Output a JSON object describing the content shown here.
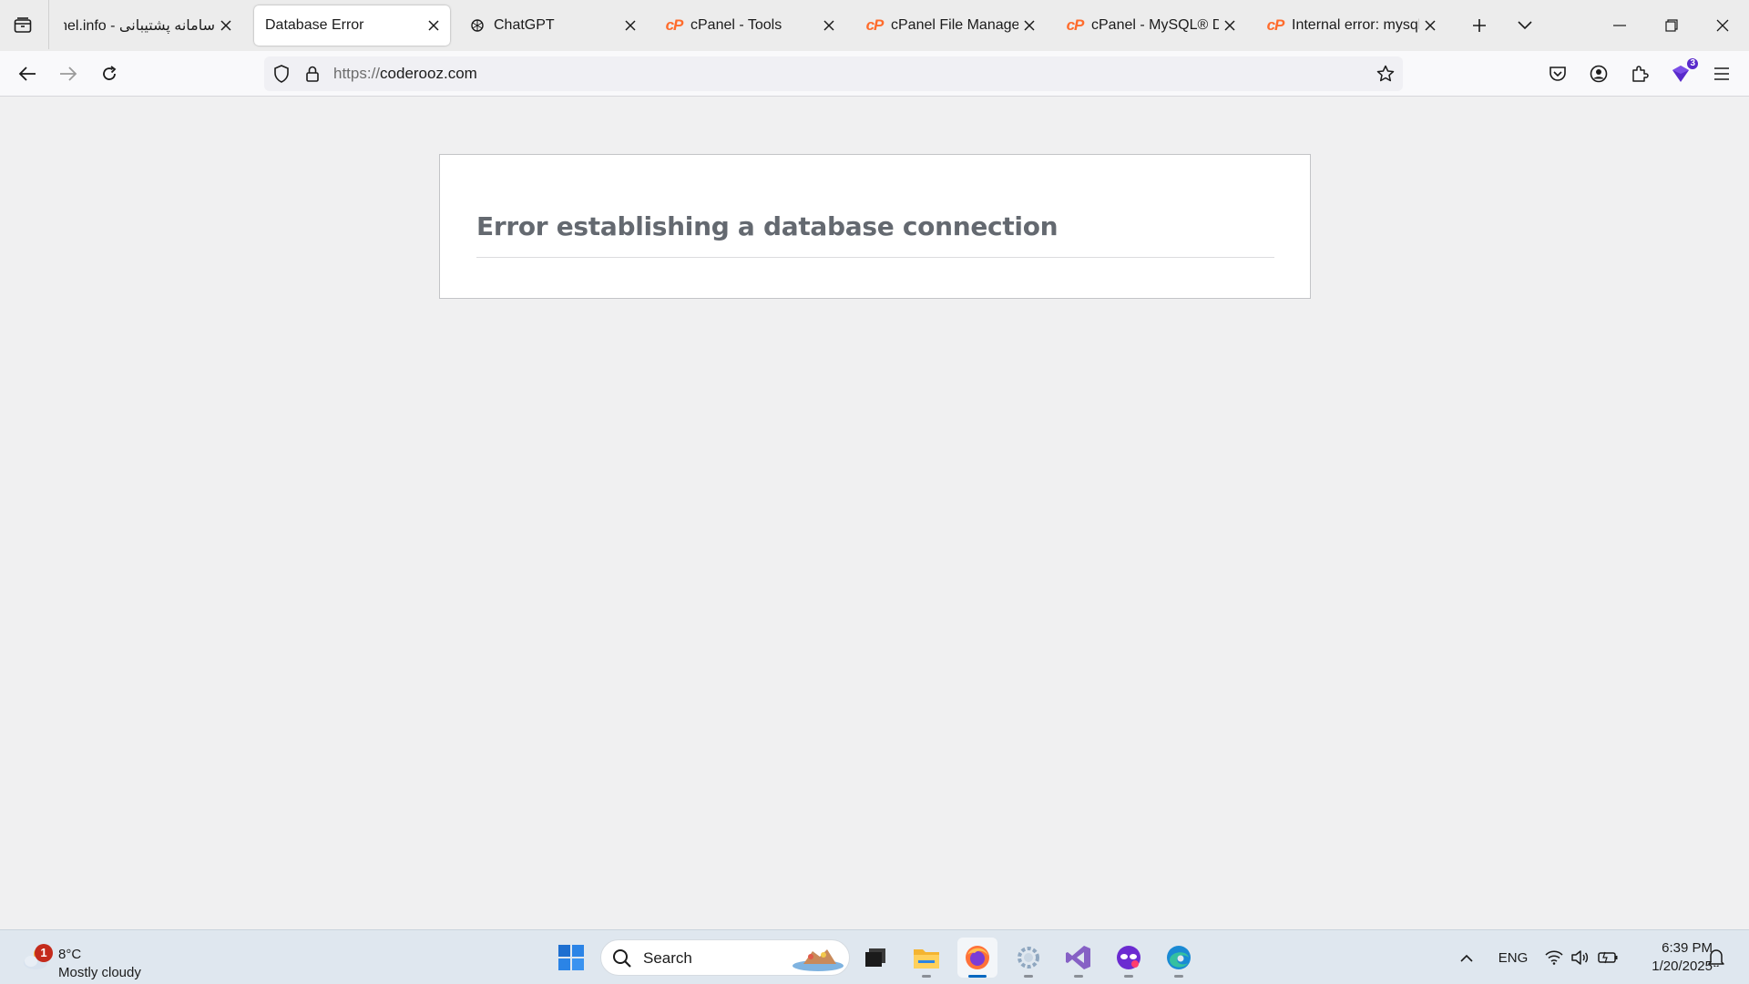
{
  "browser": {
    "tabs": [
      {
        "title": "سامانه پشتیبانی - nel.info",
        "favicon": "none",
        "active": false
      },
      {
        "title": "Database Error",
        "favicon": "none",
        "active": true
      },
      {
        "title": "ChatGPT",
        "favicon": "chatgpt-icon",
        "active": false
      },
      {
        "title": "cPanel - Tools",
        "favicon": "cpanel-icon",
        "active": false
      },
      {
        "title": "cPanel File Manager v",
        "favicon": "cpanel-icon",
        "active": false
      },
      {
        "title": "cPanel - MySQL® Dat",
        "favicon": "cpanel-icon",
        "active": false
      },
      {
        "title": "Internal error: mysqli_s",
        "favicon": "cpanel-icon",
        "active": false
      }
    ],
    "cpanel_glyph": "cP",
    "url": {
      "scheme": "https://",
      "host": "coderooz.com"
    },
    "extension_badge": "3"
  },
  "page": {
    "error_heading": "Error establishing a database connection"
  },
  "taskbar": {
    "weather": {
      "badge": "1",
      "temperature": "8°C",
      "condition": "Mostly cloudy"
    },
    "search_label": "Search",
    "language": "ENG",
    "clock": {
      "time": "6:39 PM",
      "date": "1/20/2025"
    }
  },
  "colors": {
    "cpanel_orange": "#ff6c2c",
    "error_heading": "#646970",
    "taskbar_bg": "#dfe7ef",
    "active_indicator": "#0067c0"
  }
}
